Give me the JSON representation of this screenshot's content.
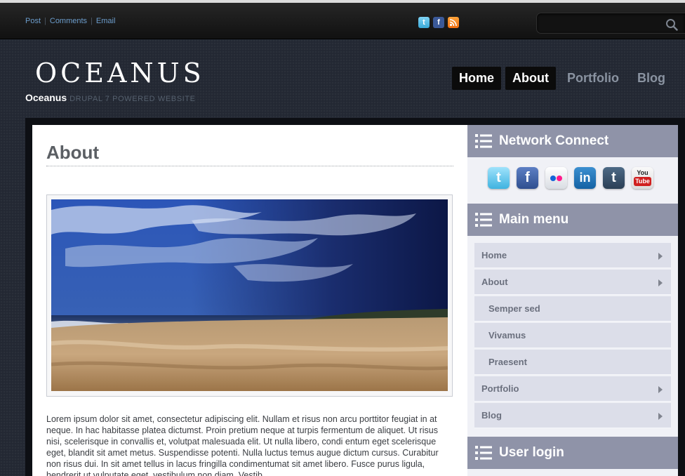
{
  "topbar": {
    "links": [
      "Post",
      "Comments",
      "Email"
    ],
    "separator": "|",
    "social": [
      "twitter-icon",
      "facebook-icon",
      "rss-icon"
    ],
    "search_placeholder": ""
  },
  "header": {
    "logo": "OCEANUS",
    "site_name": "Oceanus",
    "slogan": "DRUPAL 7 POWERED WEBSITE"
  },
  "nav": {
    "items": [
      "Home",
      "About",
      "Portfolio",
      "Blog"
    ],
    "active": [
      "Home",
      "About"
    ]
  },
  "main": {
    "title": "About",
    "body": "Lorem ipsum dolor sit amet, consectetur adipiscing elit. Nullam et risus non arcu porttitor feugiat in at neque. In hac habitasse platea dictumst. Proin pretium neque at turpis fermentum de aliquet. Ut risus nisi, scelerisque in convallis et, volutpat malesuada elit. Ut nulla libero, condi entum eget scelerisque eget, blandit sit amet metus. Suspendisse potenti. Nulla luctus temus augue dictum cursus. Curabitur non risus dui. In sit amet tellus in lacus fringilla condimentumat sit amet libero. Fusce purus ligula, hendrerit ut vulputate eget, vestibulum non diam. Vestib"
  },
  "sidebar": {
    "network": {
      "title": "Network Connect",
      "icons": [
        "twitter-icon",
        "facebook-icon",
        "flickr-icon",
        "linkedin-icon",
        "tumblr-icon",
        "youtube-icon"
      ]
    },
    "main_menu": {
      "title": "Main menu",
      "items": [
        {
          "label": "Home",
          "level": 0,
          "expandable": true
        },
        {
          "label": "About",
          "level": 0,
          "expandable": true
        },
        {
          "label": "Semper sed",
          "level": 1,
          "expandable": false
        },
        {
          "label": "Vivamus",
          "level": 1,
          "expandable": false
        },
        {
          "label": "Praesent",
          "level": 1,
          "expandable": false
        },
        {
          "label": "Portfolio",
          "level": 0,
          "expandable": true
        },
        {
          "label": "Blog",
          "level": 0,
          "expandable": true
        }
      ]
    },
    "user_login": {
      "title": "User login"
    }
  },
  "colors": {
    "page_bg": "#232833",
    "sidebar_header": "#8f93a8",
    "menu_item_bg": "#dcdee9",
    "nav_active_bg": "#0b0b0b",
    "link_blue": "#6c9dcc"
  }
}
